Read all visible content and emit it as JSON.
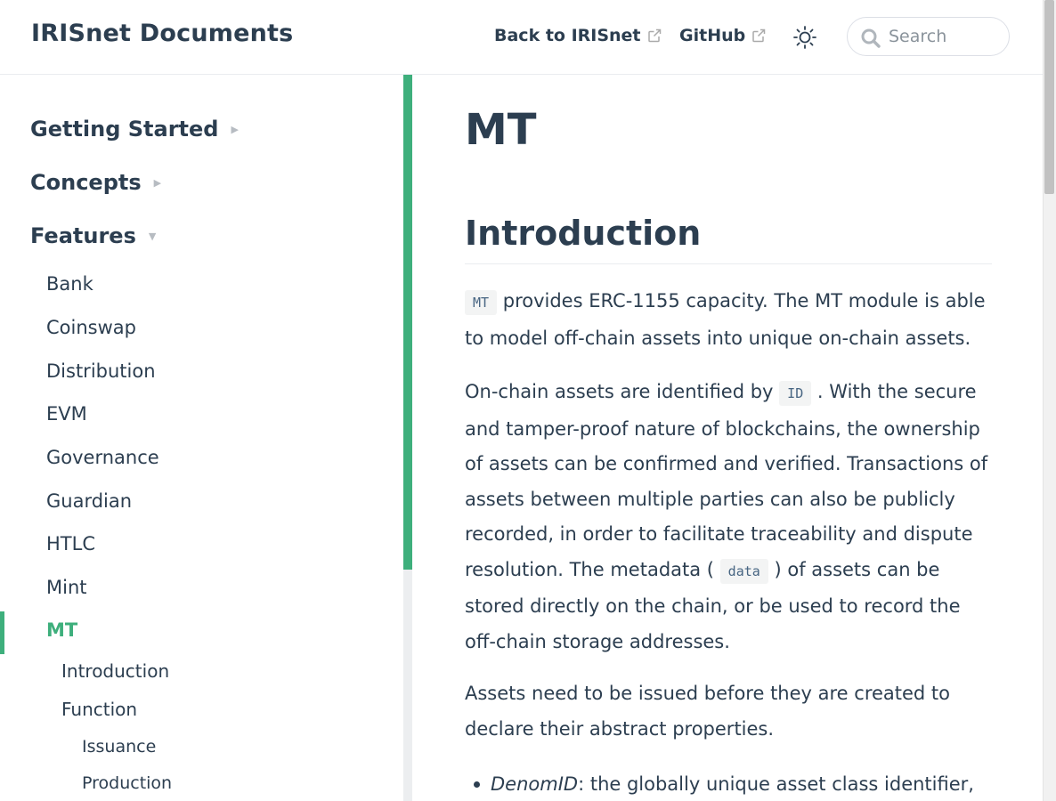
{
  "navbar": {
    "site_name": "IRISnet Documents",
    "links": [
      {
        "label": "Back to IRISnet",
        "icon": "external-link-icon"
      },
      {
        "label": "GitHub",
        "icon": "external-link-icon"
      }
    ],
    "theme_icon": "sun-icon",
    "search": {
      "placeholder": "Search",
      "value": "",
      "icon": "search-icon"
    }
  },
  "sidebar": {
    "groups": [
      {
        "label": "Getting Started",
        "caret": "▶",
        "expanded": false
      },
      {
        "label": "Concepts",
        "caret": "▶",
        "expanded": false
      },
      {
        "label": "Features",
        "caret": "▼",
        "expanded": true
      }
    ],
    "items": [
      "Bank",
      "Coinswap",
      "Distribution",
      "EVM",
      "Governance",
      "Guardian",
      "HTLC",
      "Mint",
      "MT"
    ],
    "active_item": "MT",
    "sub_items": [
      "Introduction",
      "Function"
    ],
    "sub_sub_items": [
      "Issuance",
      "Production"
    ]
  },
  "content": {
    "title": "MT",
    "heading": "Introduction",
    "p1": {
      "code": "MT",
      "text": " provides ERC-1155 capacity. The MT module is able to model off-chain assets into unique on-chain assets."
    },
    "p2": {
      "t1": "On-chain assets are identified by ",
      "code1": "ID",
      "t2": " . With the secure and tamper-proof nature of blockchains, the ownership of assets can be confirmed and verified. Transactions of assets between multiple parties can also be publicly recorded, in order to facilitate traceability and dispute resolution. The metadata ( ",
      "code2": "data",
      "t3": " ) of assets can be stored directly on the chain, or be used to record the off-chain storage addresses."
    },
    "p3": "Assets need to be issued before they are created to declare their abstract properties.",
    "bullet1": {
      "term": "DenomID",
      "text": ": the globally unique asset class identifier,"
    }
  },
  "colors": {
    "accent": "#3eaf7c",
    "text": "#2c3e50",
    "code": "#476582",
    "border": "#eaecef"
  }
}
